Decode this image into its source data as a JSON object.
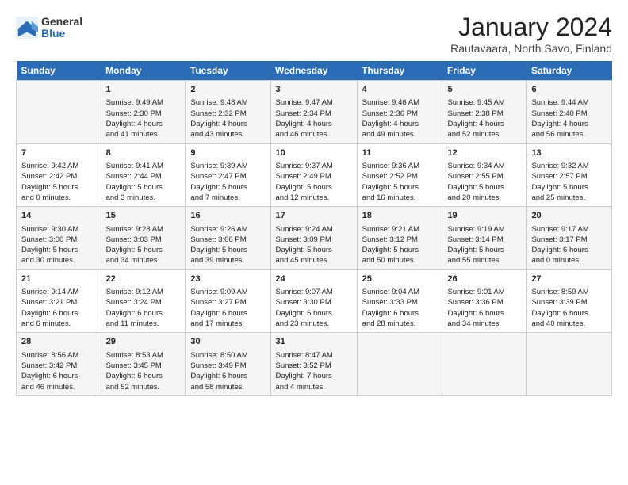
{
  "logo": {
    "general": "General",
    "blue": "Blue"
  },
  "header": {
    "title": "January 2024",
    "subtitle": "Rautavaara, North Savo, Finland"
  },
  "days": [
    "Sunday",
    "Monday",
    "Tuesday",
    "Wednesday",
    "Thursday",
    "Friday",
    "Saturday"
  ],
  "weeks": [
    [
      {
        "day": "",
        "content": ""
      },
      {
        "day": "1",
        "content": "Sunrise: 9:49 AM\nSunset: 2:30 PM\nDaylight: 4 hours\nand 41 minutes."
      },
      {
        "day": "2",
        "content": "Sunrise: 9:48 AM\nSunset: 2:32 PM\nDaylight: 4 hours\nand 43 minutes."
      },
      {
        "day": "3",
        "content": "Sunrise: 9:47 AM\nSunset: 2:34 PM\nDaylight: 4 hours\nand 46 minutes."
      },
      {
        "day": "4",
        "content": "Sunrise: 9:46 AM\nSunset: 2:36 PM\nDaylight: 4 hours\nand 49 minutes."
      },
      {
        "day": "5",
        "content": "Sunrise: 9:45 AM\nSunset: 2:38 PM\nDaylight: 4 hours\nand 52 minutes."
      },
      {
        "day": "6",
        "content": "Sunrise: 9:44 AM\nSunset: 2:40 PM\nDaylight: 4 hours\nand 56 minutes."
      }
    ],
    [
      {
        "day": "7",
        "content": "Sunrise: 9:42 AM\nSunset: 2:42 PM\nDaylight: 5 hours\nand 0 minutes."
      },
      {
        "day": "8",
        "content": "Sunrise: 9:41 AM\nSunset: 2:44 PM\nDaylight: 5 hours\nand 3 minutes."
      },
      {
        "day": "9",
        "content": "Sunrise: 9:39 AM\nSunset: 2:47 PM\nDaylight: 5 hours\nand 7 minutes."
      },
      {
        "day": "10",
        "content": "Sunrise: 9:37 AM\nSunset: 2:49 PM\nDaylight: 5 hours\nand 12 minutes."
      },
      {
        "day": "11",
        "content": "Sunrise: 9:36 AM\nSunset: 2:52 PM\nDaylight: 5 hours\nand 16 minutes."
      },
      {
        "day": "12",
        "content": "Sunrise: 9:34 AM\nSunset: 2:55 PM\nDaylight: 5 hours\nand 20 minutes."
      },
      {
        "day": "13",
        "content": "Sunrise: 9:32 AM\nSunset: 2:57 PM\nDaylight: 5 hours\nand 25 minutes."
      }
    ],
    [
      {
        "day": "14",
        "content": "Sunrise: 9:30 AM\nSunset: 3:00 PM\nDaylight: 5 hours\nand 30 minutes."
      },
      {
        "day": "15",
        "content": "Sunrise: 9:28 AM\nSunset: 3:03 PM\nDaylight: 5 hours\nand 34 minutes."
      },
      {
        "day": "16",
        "content": "Sunrise: 9:26 AM\nSunset: 3:06 PM\nDaylight: 5 hours\nand 39 minutes."
      },
      {
        "day": "17",
        "content": "Sunrise: 9:24 AM\nSunset: 3:09 PM\nDaylight: 5 hours\nand 45 minutes."
      },
      {
        "day": "18",
        "content": "Sunrise: 9:21 AM\nSunset: 3:12 PM\nDaylight: 5 hours\nand 50 minutes."
      },
      {
        "day": "19",
        "content": "Sunrise: 9:19 AM\nSunset: 3:14 PM\nDaylight: 5 hours\nand 55 minutes."
      },
      {
        "day": "20",
        "content": "Sunrise: 9:17 AM\nSunset: 3:17 PM\nDaylight: 6 hours\nand 0 minutes."
      }
    ],
    [
      {
        "day": "21",
        "content": "Sunrise: 9:14 AM\nSunset: 3:21 PM\nDaylight: 6 hours\nand 6 minutes."
      },
      {
        "day": "22",
        "content": "Sunrise: 9:12 AM\nSunset: 3:24 PM\nDaylight: 6 hours\nand 11 minutes."
      },
      {
        "day": "23",
        "content": "Sunrise: 9:09 AM\nSunset: 3:27 PM\nDaylight: 6 hours\nand 17 minutes."
      },
      {
        "day": "24",
        "content": "Sunrise: 9:07 AM\nSunset: 3:30 PM\nDaylight: 6 hours\nand 23 minutes."
      },
      {
        "day": "25",
        "content": "Sunrise: 9:04 AM\nSunset: 3:33 PM\nDaylight: 6 hours\nand 28 minutes."
      },
      {
        "day": "26",
        "content": "Sunrise: 9:01 AM\nSunset: 3:36 PM\nDaylight: 6 hours\nand 34 minutes."
      },
      {
        "day": "27",
        "content": "Sunrise: 8:59 AM\nSunset: 3:39 PM\nDaylight: 6 hours\nand 40 minutes."
      }
    ],
    [
      {
        "day": "28",
        "content": "Sunrise: 8:56 AM\nSunset: 3:42 PM\nDaylight: 6 hours\nand 46 minutes."
      },
      {
        "day": "29",
        "content": "Sunrise: 8:53 AM\nSunset: 3:45 PM\nDaylight: 6 hours\nand 52 minutes."
      },
      {
        "day": "30",
        "content": "Sunrise: 8:50 AM\nSunset: 3:49 PM\nDaylight: 6 hours\nand 58 minutes."
      },
      {
        "day": "31",
        "content": "Sunrise: 8:47 AM\nSunset: 3:52 PM\nDaylight: 7 hours\nand 4 minutes."
      },
      {
        "day": "",
        "content": ""
      },
      {
        "day": "",
        "content": ""
      },
      {
        "day": "",
        "content": ""
      }
    ]
  ]
}
